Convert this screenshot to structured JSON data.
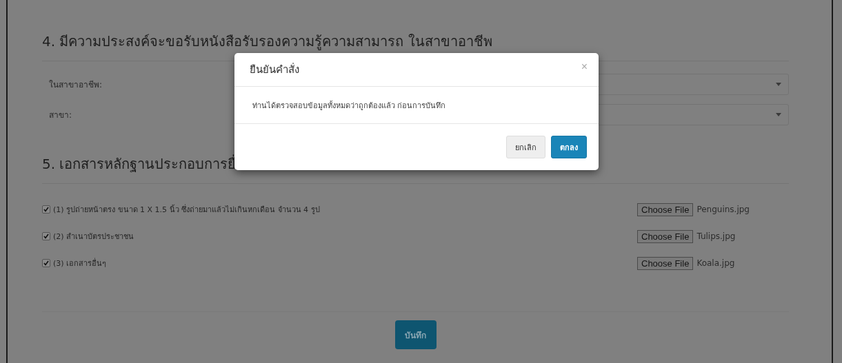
{
  "section_4": {
    "heading": "4. มีความประสงค์จะขอรับหนังสือรับรองความรู้ความสามารถ ในสาขาอาชีพ",
    "fields": [
      {
        "label": "ในสาขาอาชีพ:"
      },
      {
        "label": "สาขา:"
      }
    ]
  },
  "section_5": {
    "heading": "5. เอกสารหลักฐานประกอบการยื่",
    "documents": [
      {
        "label": "(1) รูปถ่ายหน้าตรง ขนาด 1 X 1.5 นิ้ว ซึ่งถ่ายมาแล้วไม่เกินหกเดือน จำนวน 4 รูป",
        "checked": true,
        "button": "Choose File",
        "file": "Penguins.jpg"
      },
      {
        "label": "(2) สำเนาบัตรประชาชน",
        "checked": true,
        "button": "Choose File",
        "file": "Tulips.jpg"
      },
      {
        "label": "(3) เอกสารอื่นๆ",
        "checked": true,
        "button": "Choose File",
        "file": "Koala.jpg"
      }
    ]
  },
  "save_button": "บันทึก",
  "dialog": {
    "title": "ยืนยันคำสั่ง",
    "close": "×",
    "message": "ท่านได้ตรวจสอบข้อมูลทั้งหมดว่าถูกต้องแล้ว ก่อนการบันทึก",
    "buttons": [
      {
        "label": "ยกเลิก",
        "kind": "default"
      },
      {
        "label": "ตกลง",
        "kind": "primary"
      }
    ]
  }
}
